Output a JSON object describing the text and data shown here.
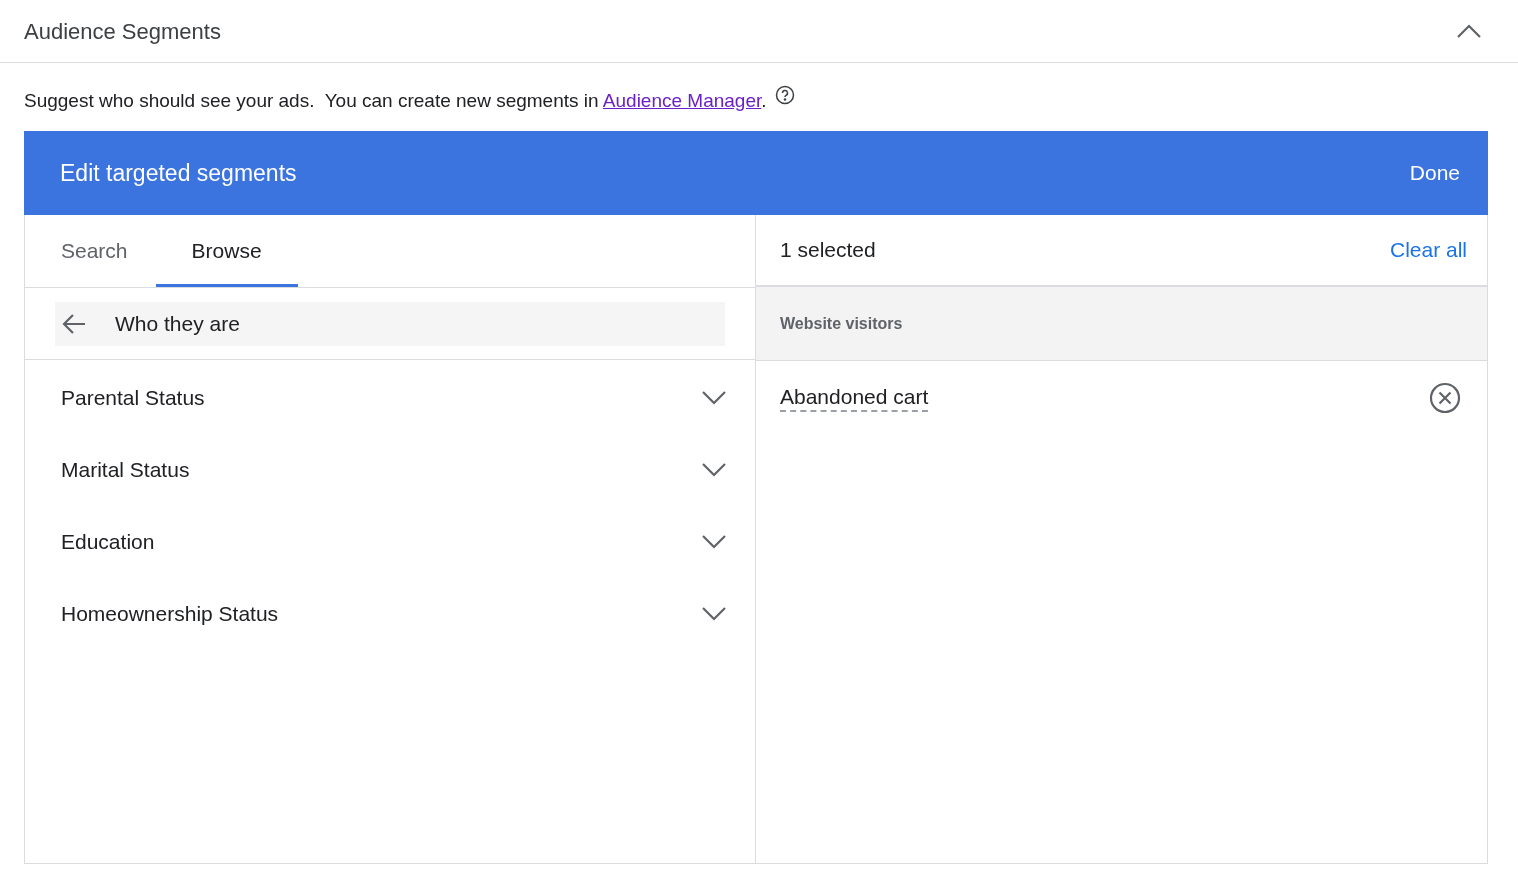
{
  "section": {
    "title": "Audience Segments",
    "expanded": true
  },
  "description": {
    "text": "Suggest who should see your ads.  You can create new segments in ",
    "link": "Audience Manager",
    "after": "."
  },
  "editor": {
    "title": "Edit targeted segments",
    "done": "Done"
  },
  "tabs": [
    {
      "label": "Search",
      "selected": false
    },
    {
      "label": "Browse",
      "selected": true
    }
  ],
  "breadcrumb": "Who they are",
  "categories": [
    {
      "label": "Parental Status",
      "expanded": false
    },
    {
      "label": "Marital Status",
      "expanded": false
    },
    {
      "label": "Education",
      "expanded": false
    },
    {
      "label": "Homeownership Status",
      "expanded": false
    }
  ],
  "selection": {
    "count": "1 selected",
    "clear": "Clear all",
    "group": "Website visitors",
    "items": [
      "Abandoned cart"
    ]
  }
}
